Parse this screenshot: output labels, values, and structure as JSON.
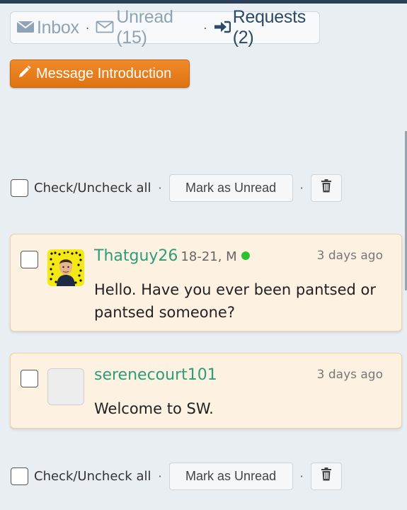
{
  "nav": {
    "inbox_label": "Inbox",
    "unread_label": "Unread (15)",
    "requests_label": "Requests (2)",
    "separator": "·"
  },
  "intro_button": {
    "label": "Message Introduction"
  },
  "bulk_actions": {
    "check_all_label": "Check/Uncheck all",
    "mark_unread_label": "Mark as Unread",
    "separator": "·"
  },
  "messages": [
    {
      "username": "Thatguy26",
      "meta": "18-21, M",
      "online": true,
      "time": "3 days ago",
      "text": "Hello. Have you ever been pantsed or pantsed someone?"
    },
    {
      "username": "serenecourt101",
      "meta": "",
      "online": false,
      "time": "3 days ago",
      "text": "Welcome to SW."
    }
  ],
  "colors": {
    "accent_orange": "#e57e1c",
    "username_green": "#2e9c7a",
    "card_bg": "#fdf1e2",
    "online_dot": "#2dc22d"
  }
}
